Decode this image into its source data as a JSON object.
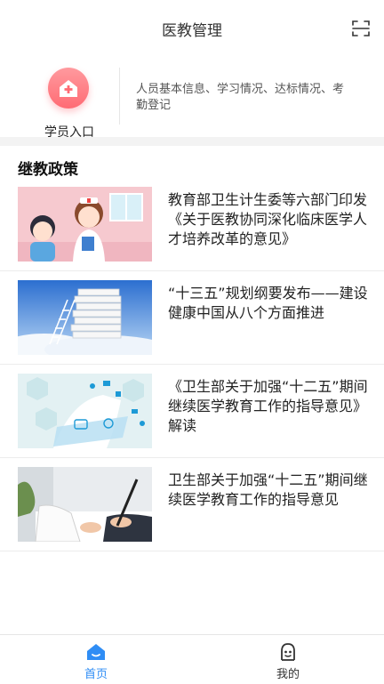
{
  "header": {
    "title": "医教管理"
  },
  "entry": {
    "label": "学员入口",
    "description": "人员基本信息、学习情况、达标情况、考勤登记"
  },
  "section": {
    "title": "继教政策"
  },
  "news": [
    {
      "title": "教育部卫生计生委等六部门印发《关于医教协同深化临床医学人才培养改革的意见》"
    },
    {
      "title": "“十三五”规划纲要发布——建设健康中国从八个方面推进"
    },
    {
      "title": "《卫生部关于加强“十二五”期间继续医学教育工作的指导意见》解读"
    },
    {
      "title": "卫生部关于加强“十二五”期间继续医学教育工作的指导意见"
    }
  ],
  "tabbar": {
    "home_label": "首页",
    "mine_label": "我的"
  },
  "colors": {
    "accent": "#2f8df5",
    "entry_icon": "#ff6b74"
  }
}
